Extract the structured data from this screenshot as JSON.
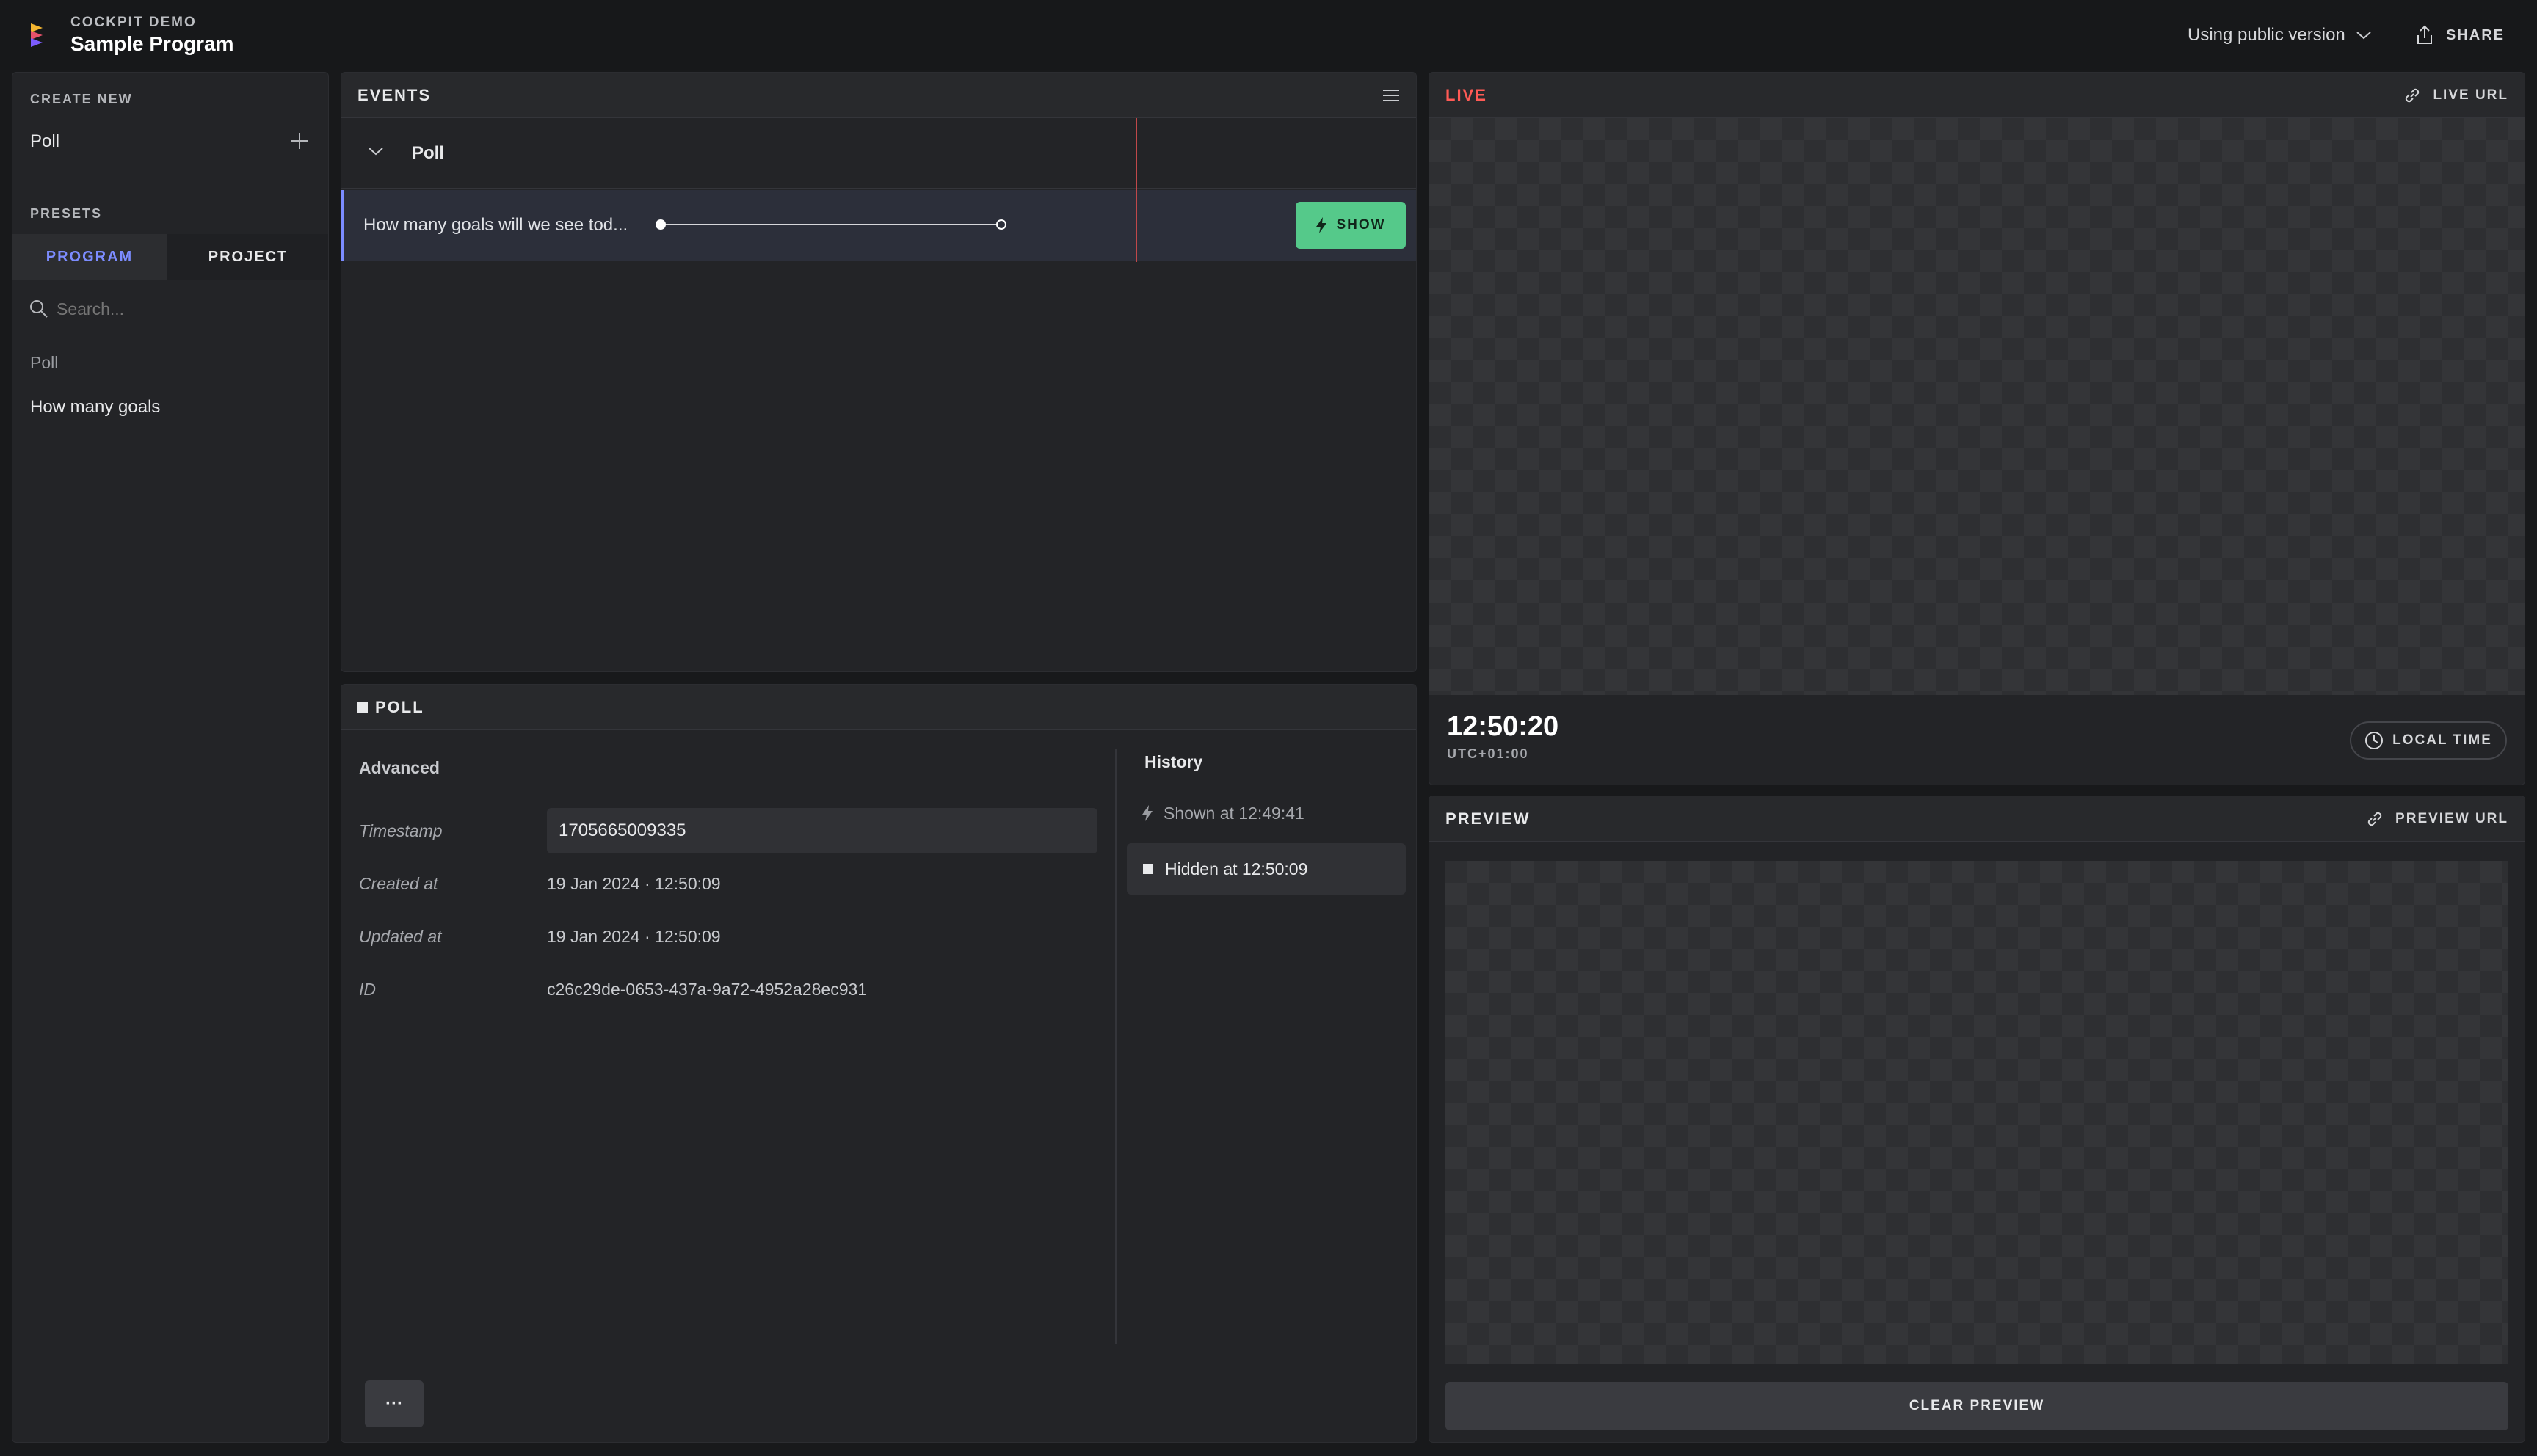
{
  "header": {
    "app_name": "COCKPIT DEMO",
    "program_title": "Sample Program",
    "version_label": "Using public version",
    "share_label": "SHARE"
  },
  "sidebar": {
    "create_new_label": "CREATE NEW",
    "create_items": [
      {
        "label": "Poll"
      }
    ],
    "presets_label": "PRESETS",
    "tabs": [
      {
        "label": "PROGRAM",
        "active": true
      },
      {
        "label": "PROJECT",
        "active": false
      }
    ],
    "search_placeholder": "Search...",
    "group_label": "Poll",
    "preset_items": [
      {
        "label": "How many goals"
      }
    ]
  },
  "events": {
    "title": "EVENTS",
    "group_label": "Poll",
    "rows": [
      {
        "label": "How many goals will we see tod...",
        "action_label": "SHOW"
      }
    ]
  },
  "poll": {
    "title": "POLL",
    "advanced_label": "Advanced",
    "fields": {
      "timestamp_label": "Timestamp",
      "timestamp_value": "1705665009335",
      "created_label": "Created at",
      "created_value": "19 Jan 2024 · 12:50:09",
      "updated_label": "Updated at",
      "updated_value": "19 Jan 2024 · 12:50:09",
      "id_label": "ID",
      "id_value": "c26c29de-0653-437a-9a72-4952a28ec931"
    },
    "history_label": "History",
    "history": [
      {
        "label": "Shown at 12:49:41",
        "type": "shown"
      },
      {
        "label": "Hidden at 12:50:09",
        "type": "hidden"
      }
    ],
    "more_label": "···"
  },
  "live": {
    "title": "LIVE",
    "url_label": "LIVE URL",
    "time": "12:50:20",
    "timezone": "UTC+01:00",
    "local_time_label": "LOCAL TIME"
  },
  "preview": {
    "title": "PREVIEW",
    "url_label": "PREVIEW URL",
    "clear_label": "CLEAR PREVIEW"
  },
  "colors": {
    "accent": "#7c8cff",
    "live": "#ff5a55",
    "show": "#55c98a"
  }
}
